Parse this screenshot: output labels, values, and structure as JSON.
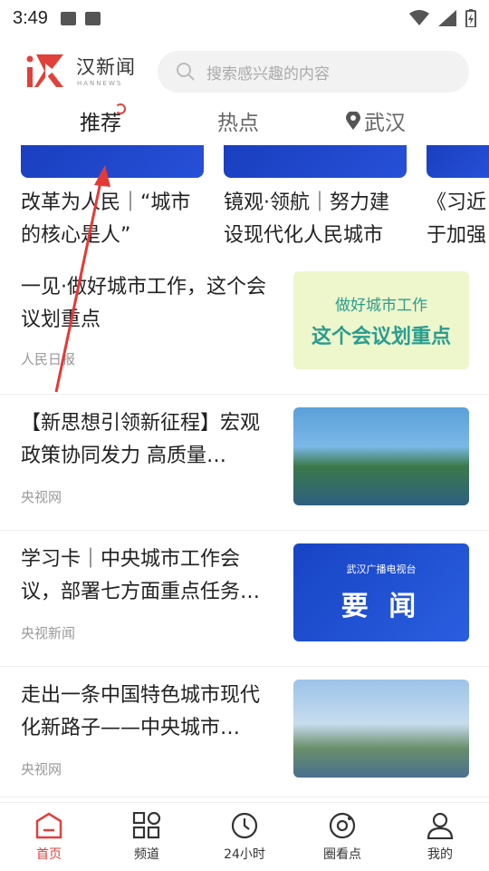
{
  "status": {
    "time": "3:49"
  },
  "app": {
    "logo_text": "汉新闻",
    "logo_sub": "HANNEWS"
  },
  "search": {
    "placeholder": "搜索感兴趣的内容"
  },
  "tabs": [
    {
      "label": "推荐",
      "active": true
    },
    {
      "label": "热点",
      "active": false
    },
    {
      "label": "武汉",
      "active": false,
      "icon": "location-pin-icon"
    }
  ],
  "carousel": [
    {
      "line1": "改革为人民｜“城市",
      "line2": "的核心是人”"
    },
    {
      "line1": "镜观·领航｜努力建",
      "line2": "设现代化人民城市"
    },
    {
      "line1": "《习近",
      "line2": "于加强"
    }
  ],
  "news": [
    {
      "title": "一见·做好城市工作，这个会议划重点",
      "source": "人民日报",
      "thumb_text1": "做好城市工作",
      "thumb_text2": "这个会议划重点"
    },
    {
      "title": "【新思想引领新征程】宏观政策协同发力 高质量…",
      "source": "央视网"
    },
    {
      "title": "学习卡｜中央城市工作会议，部署七方面重点任务…",
      "source": "央视新闻",
      "thumb_brand": "武汉广播电视台",
      "thumb_big": "要 闻"
    },
    {
      "title": "走出一条中国特色城市现代化新路子——中央城市…",
      "source": "央视网"
    }
  ],
  "bottom_nav": [
    {
      "label": "首页",
      "icon": "home-icon",
      "active": true
    },
    {
      "label": "频道",
      "icon": "grid-icon",
      "active": false
    },
    {
      "label": "24小时",
      "icon": "clock-icon",
      "active": false
    },
    {
      "label": "圈看点",
      "icon": "circle-view-icon",
      "active": false
    },
    {
      "label": "我的",
      "icon": "profile-icon",
      "active": false
    }
  ],
  "colors": {
    "accent": "#e0413b",
    "blue": "#1a3fbf"
  }
}
